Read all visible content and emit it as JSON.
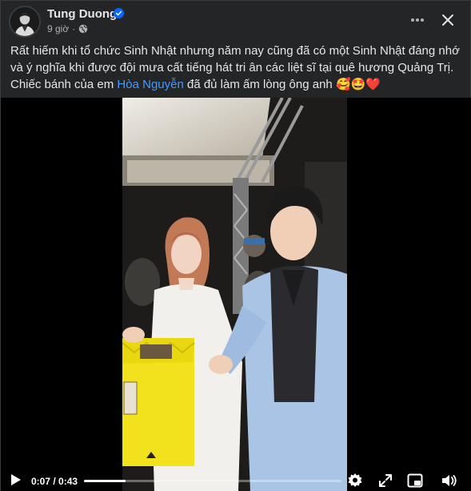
{
  "post": {
    "author": "Tung Duong",
    "time": "9 giờ",
    "caption_before": "Rất hiếm khi tổ chức Sinh Nhật nhưng năm nay cũng đã có một Sinh Nhật đáng nhớ và ý nghĩa khi được đội mưa cất tiếng hát tri ân các liệt sĩ tại quê hương Quảng Trị. Chiếc bánh của em ",
    "caption_tag": "Hòa Nguyễn",
    "caption_after": " đã đủ làm ấm lòng ông anh ",
    "caption_emoji": "🥰🤩❤️"
  },
  "icons": {
    "verified": "verified-badge-icon",
    "audience": "globe-icon",
    "more": "more-options-icon",
    "close": "close-icon",
    "play": "play-icon",
    "settings": "gear-icon",
    "fullscreen": "expand-icon",
    "pip": "picture-in-picture-icon",
    "volume": "volume-icon"
  },
  "video": {
    "current_time": "0:07",
    "duration": "0:43",
    "time_display": "0:07 / 0:43",
    "progress": 0.163
  },
  "colors": {
    "background": "#242526",
    "text": "#e4e6eb",
    "secondary_text": "#b0b3b8",
    "link": "#4599ff",
    "verified": "#0866ff",
    "video_bg": "#000000"
  }
}
